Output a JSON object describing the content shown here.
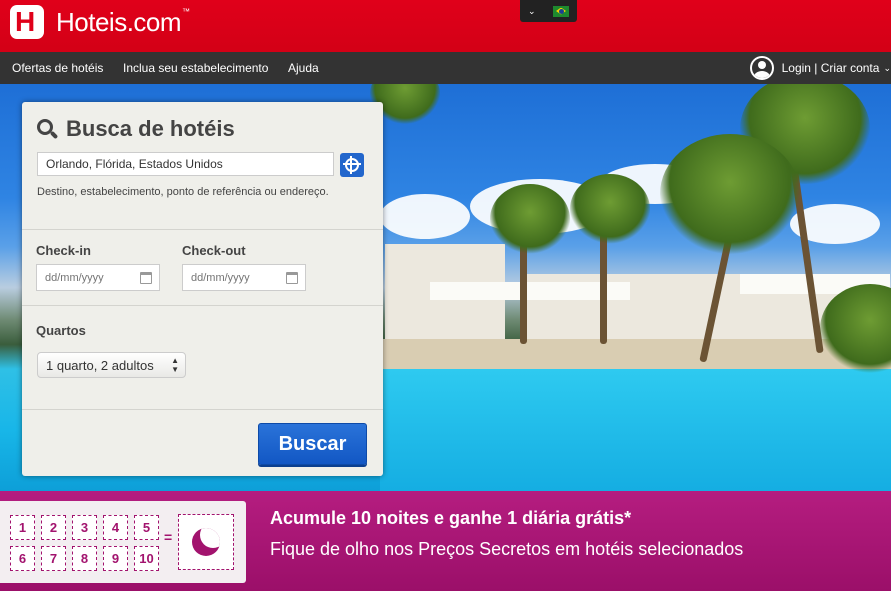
{
  "header": {
    "brand": "Hoteis.com",
    "brand_tm": "™",
    "locale_flag": "brazil-flag-icon"
  },
  "nav": {
    "items": [
      "Ofertas de hotéis",
      "Inclua seu estabelecimento",
      "Ajuda"
    ],
    "login_label": "Login | Criar conta"
  },
  "search": {
    "title": "Busca de hotéis",
    "destination_value": "Orlando, Flórida, Estados Unidos",
    "destination_hint": "Destino, estabelecimento, ponto de referência ou endereço.",
    "checkin_label": "Check-in",
    "checkin_placeholder": "dd/mm/yyyy",
    "checkout_label": "Check-out",
    "checkout_placeholder": "dd/mm/yyyy",
    "rooms_label": "Quartos",
    "rooms_value": "1 quarto, 2 adultos",
    "submit_label": "Buscar"
  },
  "promo": {
    "nights": [
      "1",
      "2",
      "3",
      "4",
      "5",
      "6",
      "7",
      "8",
      "9",
      "10"
    ],
    "equals": "=",
    "title": "Acumule 10 noites e ganhe 1 diária grátis*",
    "subtitle": "Fique de olho nos Preços Secretos em hotéis selecionados"
  },
  "colors": {
    "brand_red": "#e0001a",
    "nav_bg": "#333333",
    "button_blue": "#1a63cf",
    "promo_magenta": "#a2136e"
  }
}
